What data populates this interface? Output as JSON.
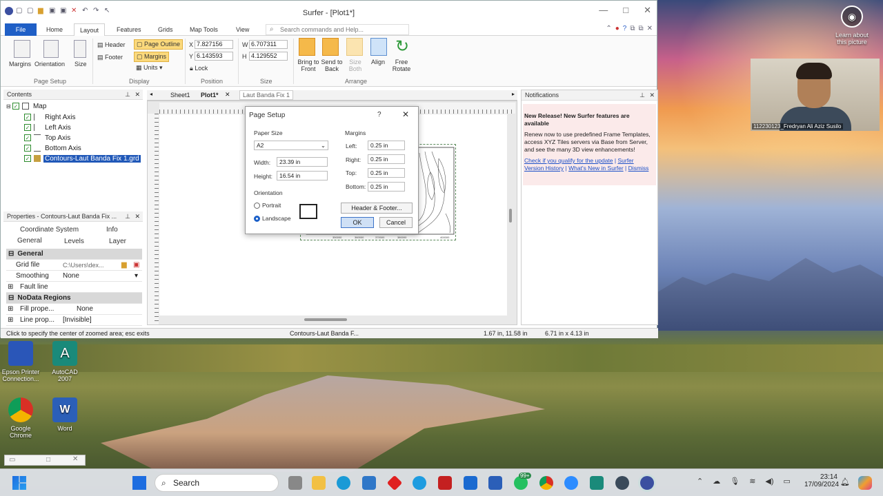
{
  "window": {
    "title": "Surfer - [Plot1*]",
    "ribbon_tabs": [
      "File",
      "Home",
      "Layout",
      "Features",
      "Grids",
      "Map Tools",
      "View"
    ],
    "active_tab": "Layout",
    "command_search_placeholder": "Search commands and Help..."
  },
  "ribbon": {
    "page_setup": {
      "margins": "Margins",
      "orientation": "Orientation",
      "size": "Size",
      "group": "Page Setup"
    },
    "display": {
      "header": "Header",
      "footer": "Footer",
      "page_outline": "Page Outline",
      "margins": "Margins",
      "units": "Units",
      "group": "Display"
    },
    "position": {
      "x_label": "X",
      "x_value": "7.827156",
      "y_label": "Y",
      "y_value": "6.143593",
      "lock": "Lock",
      "group": "Position"
    },
    "size": {
      "w_label": "W",
      "w_value": "6.707311",
      "h_label": "H",
      "h_value": "4.129552",
      "group": "Size"
    },
    "arrange": {
      "bring_to_front": "Bring to Front",
      "send_to_back": "Send to Back",
      "size_both": "Size Both",
      "align": "Align",
      "free_rotate": "Free Rotate",
      "group": "Arrange"
    }
  },
  "contents": {
    "title": "Contents",
    "items": [
      "Map",
      "Right Axis",
      "Left Axis",
      "Top Axis",
      "Bottom Axis",
      "Contours-Laut Banda Fix 1.grd"
    ]
  },
  "properties": {
    "title": "Properties - Contours-Laut Banda Fix ...",
    "tabs_row1": [
      "Coordinate System",
      "Info"
    ],
    "tabs_row2": [
      "General",
      "Levels",
      "Layer"
    ],
    "section_general": "General",
    "grid_file_label": "Grid file",
    "grid_file_value": "C:\\Users\\dex...",
    "smoothing_label": "Smoothing",
    "smoothing_value": "None",
    "fault_line_label": "Fault line",
    "section_nodata": "NoData Regions",
    "fill_label": "Fill prope...",
    "fill_value": "None",
    "line_label": "Line prop...",
    "line_value": "[Invisible]"
  },
  "doc_tabs": [
    "Sheet1",
    "Plot1*",
    "Laut Banda Fix 1"
  ],
  "dialog": {
    "title": "Page Setup",
    "help": "?",
    "paper_size_label": "Paper Size",
    "paper_size_value": "A2",
    "width_label": "Width:",
    "width_value": "23.39 in",
    "height_label": "Height:",
    "height_value": "16.54 in",
    "orientation_label": "Orientation",
    "portrait": "Portrait",
    "landscape": "Landscape",
    "margins_label": "Margins",
    "left_label": "Left:",
    "left_value": "0.25 in",
    "right_label": "Right:",
    "right_value": "0.25 in",
    "top_label": "Top:",
    "top_value": "0.25 in",
    "bottom_label": "Bottom:",
    "bottom_value": "0.25 in",
    "header_footer": "Header & Footer...",
    "ok": "OK",
    "cancel": "Cancel"
  },
  "map_ticks": [
    "350000",
    "360000",
    "370000",
    "380000",
    "400000"
  ],
  "notifications": {
    "title": "Notifications",
    "headline": "New Release! New Surfer features are available",
    "body": "Renew now to use predefined Frame Templates, access XYZ Tiles servers via Base from Server, and see the many 3D view enhancements!",
    "link1": "Check if you qualify for the update",
    "link2": "Surfer Version History",
    "link3": "What's New in Surfer",
    "link4": "Dismiss"
  },
  "status": {
    "hint": "Click to specify the center of zoomed area; esc exits",
    "object": "Contours-Laut Banda F...",
    "cursor": "1.67 in, 11.58 in",
    "size": "6.71 in x 4.13 in"
  },
  "desktop": [
    {
      "label": "Epson Printer Connection...",
      "color": "#2a56b8"
    },
    {
      "label": "AutoCAD 2007",
      "color": "#1a8a7a"
    },
    {
      "label": "Google Chrome",
      "color": "#e0a020"
    },
    {
      "label": "Word",
      "color": "#2b5fb8"
    }
  ],
  "learn_about": "Learn about this picture",
  "webcam_name": "112230123_Fredryan Ali Aziz Susilo",
  "taskbar": {
    "search": "Search",
    "time": "23:14",
    "date": "17/09/2024",
    "badge": "99+"
  }
}
